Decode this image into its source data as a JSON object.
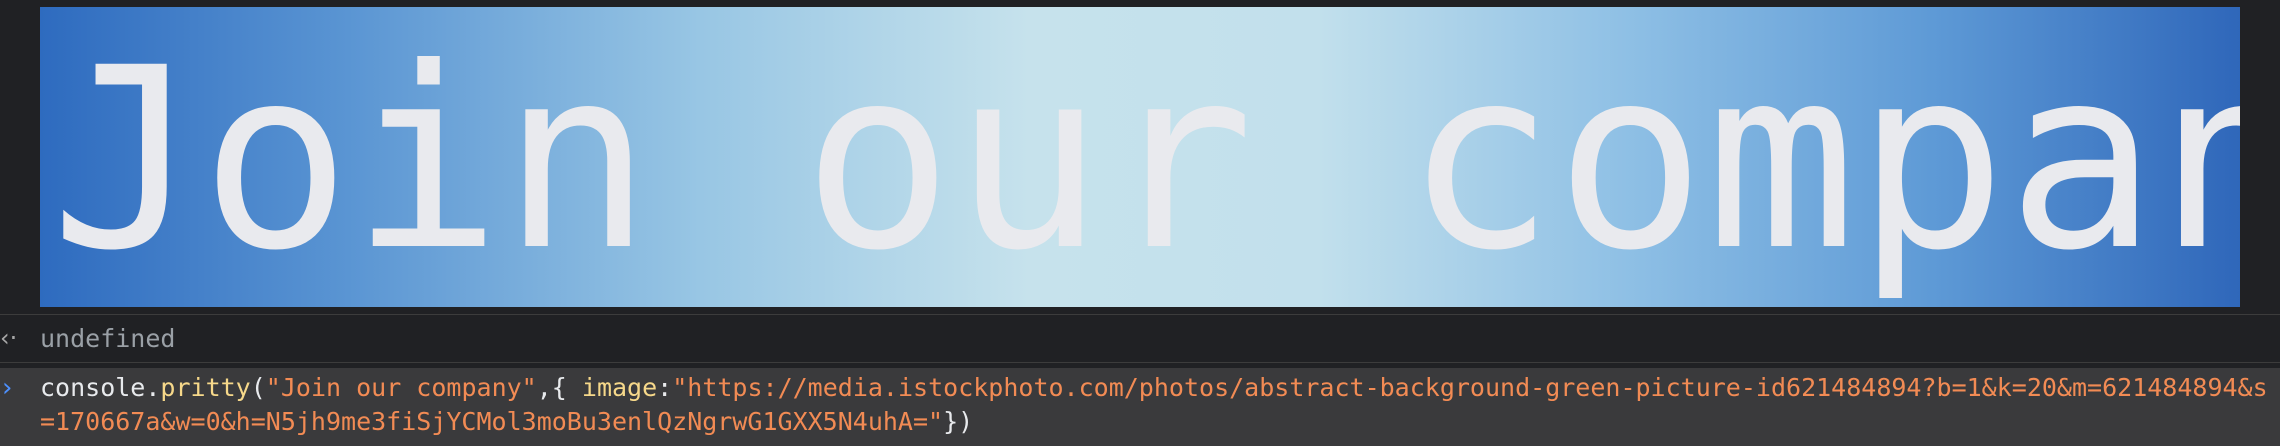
{
  "log_image": {
    "text": "Join our company"
  },
  "result": {
    "icon": "return-arrow-icon",
    "text": "undefined"
  },
  "input": {
    "icon": "prompt-chevron-icon",
    "obj": "console",
    "dot": ".",
    "method": "pritty",
    "open_paren": "(",
    "arg_string": "\"Join our company\"",
    "comma_brace": ",{ ",
    "key": "image",
    "colon": ":",
    "url_string": "\"https://media.istockphoto.com/photos/abstract-background-green-picture-id621484894?b=1&k=20&m=621484894&s=170667a&w=0&h=N5jh9me3fiSjYCMol3moBu3enlQzNgrwG1GXX5N4uhA=\"",
    "close": "})"
  },
  "colors": {
    "background": "#202124",
    "input_row": "#3a3a3c",
    "string": "#f28b54",
    "function": "#f6d88a",
    "prompt": "#4d90fe",
    "result": "#9aa0a6"
  }
}
